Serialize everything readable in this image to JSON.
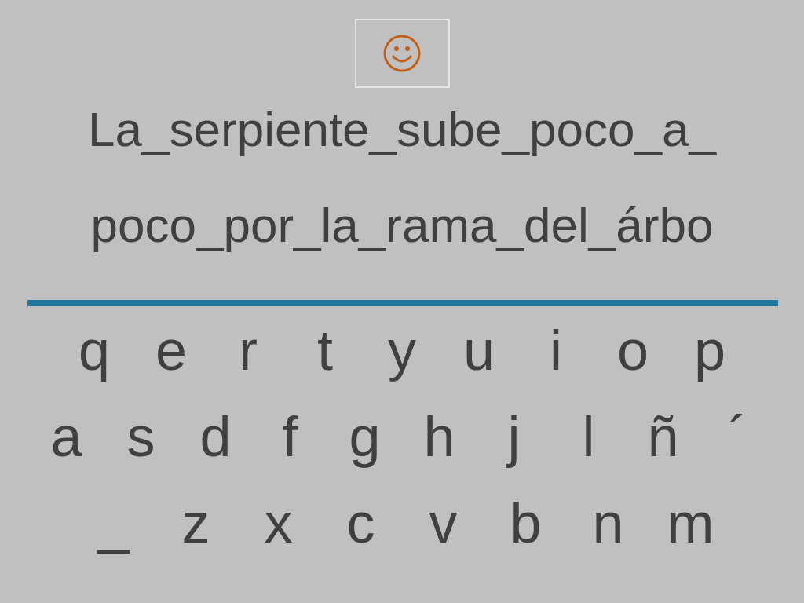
{
  "sentence_lines": [
    "La_serpiente_sube_poco_a_",
    "poco_por_la_rama_del_árbo"
  ],
  "keyboard_rows": [
    [
      "q",
      "e",
      "r",
      "t",
      "y",
      "u",
      "i",
      "o",
      "p"
    ],
    [
      "a",
      "s",
      "d",
      "f",
      "g",
      "h",
      "j",
      "l",
      "ñ",
      "´"
    ],
    [
      "_",
      "z",
      "x",
      "c",
      "v",
      "b",
      "n",
      "m"
    ]
  ]
}
